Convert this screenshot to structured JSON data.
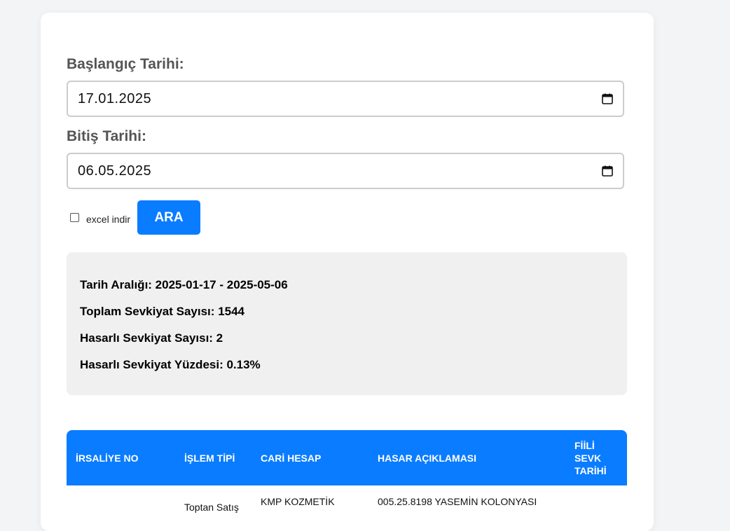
{
  "form": {
    "start_label": "Başlangıç Tarihi:",
    "start_value": "17.01.2025",
    "end_label": "Bitiş Tarihi:",
    "end_value": "06.05.2025",
    "excel_label": "excel indir",
    "excel_checked": false,
    "search_label": "ARA"
  },
  "summary": {
    "date_range": "Tarih Aralığı: 2025-01-17 - 2025-05-06",
    "total": "Toplam Sevkiyat Sayısı: 1544",
    "damaged": "Hasarlı Sevkiyat Sayısı: 2",
    "damaged_percent": "Hasarlı Sevkiyat Yüzdesi: 0.13%"
  },
  "table": {
    "headers": [
      "İRSALİYE NO",
      "İŞLEM TİPİ",
      "CARİ HESAP",
      "HASAR AÇIKLAMASI",
      "FİİLİ SEVK TARİHİ"
    ],
    "rows": [
      [
        "",
        "Toptan Satış",
        "KMP KOZMETİK",
        "005.25.8198 YASEMİN KOLONYASI",
        ""
      ]
    ]
  },
  "colors": {
    "accent": "#0a7cff",
    "summary_bg": "#f0f0f0",
    "page_bg": "#f3f4f6"
  },
  "icons": {
    "calendar": "calendar-icon"
  }
}
